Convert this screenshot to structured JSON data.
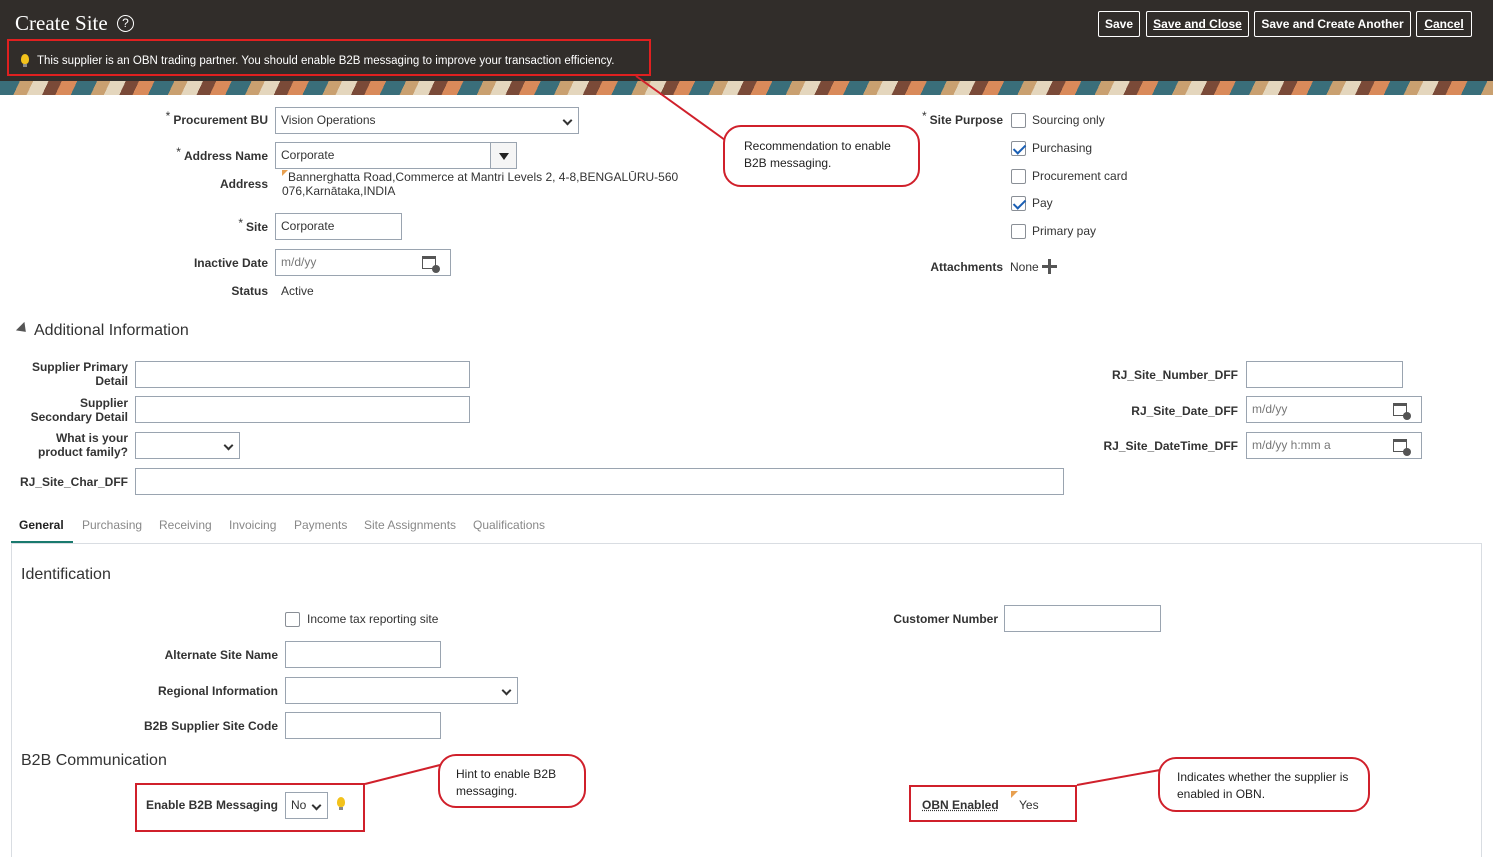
{
  "header": {
    "title": "Create Site",
    "help": "?",
    "buttons": {
      "save": "Save",
      "save_close": "Save and Close",
      "save_another": "Save and Create Another",
      "cancel": "Cancel"
    },
    "obn_message": "This supplier is an OBN trading partner. You should enable B2B messaging to improve your transaction efficiency."
  },
  "form": {
    "req_mark": "*",
    "procurement_bu_label": "Procurement BU",
    "procurement_bu": "Vision Operations",
    "address_name_label": "Address Name",
    "address_name": "Corporate",
    "address_label": "Address",
    "address_line1": "Bannerghatta Road,Commerce at Mantri Levels 2, 4-8,BENGALŪRU-560",
    "address_line2": "076,Karnātaka,INDIA",
    "site_label": "Site",
    "site": "Corporate",
    "inactive_date_label": "Inactive Date",
    "inactive_date_placeholder": "m/d/yy",
    "status_label": "Status",
    "status": "Active",
    "site_purpose_label": "Site Purpose",
    "purposes": [
      {
        "label": "Sourcing only",
        "checked": false
      },
      {
        "label": "Purchasing",
        "checked": true
      },
      {
        "label": "Procurement card",
        "checked": false
      },
      {
        "label": "Pay",
        "checked": true
      },
      {
        "label": "Primary pay",
        "checked": false
      }
    ],
    "attachments_label": "Attachments",
    "attachments": "None"
  },
  "additional": {
    "title": "Additional Information",
    "primary_detail": "Supplier Primary Detail",
    "secondary_detail": "Supplier Secondary Detail",
    "product_family": "What is your product family?",
    "site_char": "RJ_Site_Char_DFF",
    "site_number": "RJ_Site_Number_DFF",
    "site_date": "RJ_Site_Date_DFF",
    "site_date_ph": "m/d/yy",
    "site_datetime": "RJ_Site_DateTime_DFF",
    "site_datetime_ph": "m/d/yy h:mm a"
  },
  "tabs": [
    "General",
    "Purchasing",
    "Receiving",
    "Invoicing",
    "Payments",
    "Site Assignments",
    "Qualifications"
  ],
  "general": {
    "identification": "Identification",
    "income_tax": "Income tax reporting site",
    "customer_number": "Customer Number",
    "alt_site_name": "Alternate Site Name",
    "regional_info": "Regional Information",
    "b2b_code": "B2B Supplier Site Code",
    "b2b_title": "B2B Communication",
    "enable_b2b": "Enable B2B Messaging",
    "enable_b2b_value": "No",
    "obn_enabled": "OBN Enabled",
    "obn_value": "Yes"
  },
  "callouts": {
    "c1": "Recommendation to enable B2B messaging.",
    "c2": "Hint to enable B2B messaging.",
    "c3": "Indicates whether the supplier is enabled in OBN."
  }
}
